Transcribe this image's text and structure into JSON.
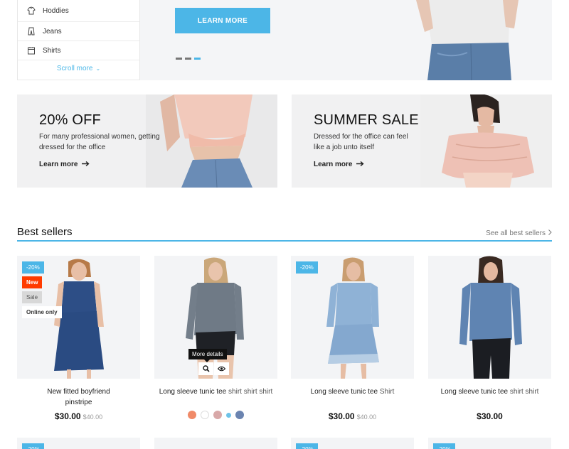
{
  "sidebar": {
    "items": [
      {
        "label": "Hoddies",
        "icon": "hoodie-icon"
      },
      {
        "label": "Jeans",
        "icon": "jeans-icon"
      },
      {
        "label": "Shirts",
        "icon": "shirt-icon"
      }
    ],
    "scroll_more": "Scroll more"
  },
  "hero": {
    "button_label": "LEARN MORE",
    "slide_count": 3,
    "active_slide": 3
  },
  "promos": [
    {
      "title": "20% OFF",
      "description": "For many professional women, getting dressed for the office",
      "link": "Learn more"
    },
    {
      "title": "SUMMER SALE",
      "description": "Dressed for the office can feel like a job unto itself",
      "link": "Learn more"
    }
  ],
  "best_sellers": {
    "title": "Best sellers",
    "see_all": "See all best sellers",
    "products": [
      {
        "name": "New fitted boyfriend pinstripe",
        "price": "$30.00",
        "old_price": "$40.00",
        "badges": {
          "discount": "-20%",
          "new": "New",
          "sale": "Sale",
          "online": "Online only"
        }
      },
      {
        "name_main": "Long sleeve tunic tee",
        "name_muted": "shirt shirt shirt",
        "tooltip": "More details",
        "swatches": [
          "#f08a68",
          "#ffffff",
          "#d8a8a8",
          "#6ec3e8",
          "#6b84b0"
        ]
      },
      {
        "name_main": "Long sleeve tunic tee",
        "name_muted": "Shirt",
        "price": "$30.00",
        "old_price": "$40.00",
        "badges": {
          "discount": "-20%"
        }
      },
      {
        "name_main": "Long sleeve tunic tee",
        "name_muted": "shirt shirt",
        "price": "$30.00"
      }
    ],
    "next_row_badges": [
      "-20%",
      "-20%",
      "-20%"
    ]
  },
  "colors": {
    "accent": "#4cb6e7",
    "new_badge": "#ff3b00"
  }
}
